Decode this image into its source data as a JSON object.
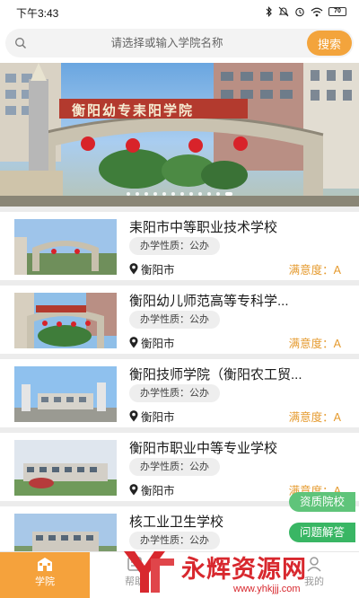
{
  "status_bar": {
    "time": "下午3:43",
    "icons": [
      "bluetooth-icon",
      "mute-icon",
      "alarm-icon",
      "wifi-icon",
      "battery-icon"
    ],
    "battery": "70"
  },
  "search": {
    "placeholder": "请选择或输入学院名称",
    "button_label": "搜索"
  },
  "banner": {
    "gate_sign": "衡阳幼专耒阳学院",
    "slides_count": 12,
    "active_index": 11
  },
  "schools": [
    {
      "name": "耒阳市中等职业技术学校",
      "nature": "办学性质：公办",
      "location": "衡阳市",
      "rating": "满意度：A"
    },
    {
      "name": "衡阳幼儿师范高等专科学...",
      "nature": "办学性质：公办",
      "location": "衡阳市",
      "rating": "满意度：A"
    },
    {
      "name": "衡阳技师学院（衡阳农工贸...",
      "nature": "办学性质：公办",
      "location": "衡阳市",
      "rating": "满意度：A"
    },
    {
      "name": "衡阳市职业中等专业学校",
      "nature": "办学性质：公办",
      "location": "衡阳市",
      "rating": "满意度：A"
    },
    {
      "name": "核工业卫生学校",
      "nature": "办学性质：公办",
      "location": "",
      "rating": ""
    }
  ],
  "float_buttons": {
    "premium": "资质院校",
    "qa": "问题解答"
  },
  "tabs": [
    {
      "label": "学院",
      "icon": "school-icon",
      "active": true
    },
    {
      "label": "帮助",
      "icon": "help-icon",
      "active": false
    },
    {
      "label": "",
      "icon": "",
      "active": false
    },
    {
      "label": "我的",
      "icon": "user-icon",
      "active": false
    }
  ],
  "watermark": {
    "text": "永辉资源网",
    "url": "www.yhkjjj.com"
  },
  "colors": {
    "accent": "#f3a43c",
    "rating": "#e59a2e",
    "float_green": "#39b664",
    "watermark_red": "#d8282e"
  }
}
